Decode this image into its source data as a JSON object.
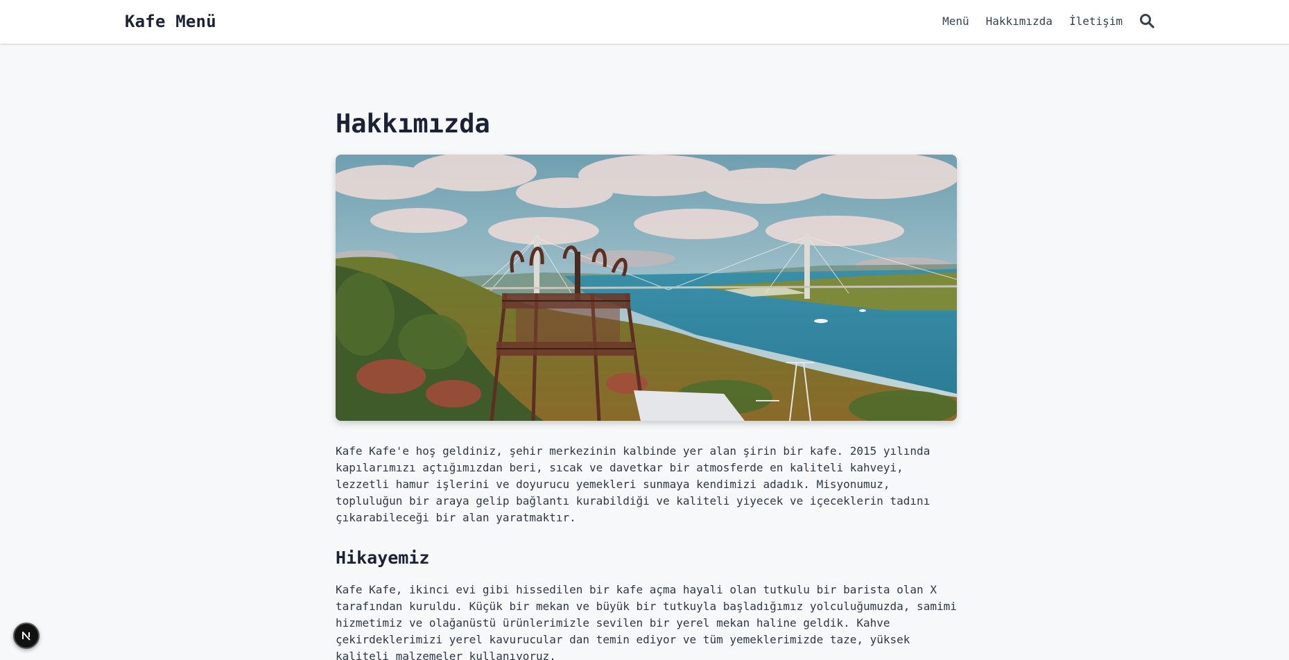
{
  "header": {
    "brand": "Kafe Menü",
    "nav": [
      "Menü",
      "Hakkımızda",
      "İletişim"
    ],
    "search_icon": "search-icon"
  },
  "page": {
    "title": "Hakkımızda",
    "hero_image": "istanbul-bosphorus-bridge-observation-tower-photo",
    "intro": "Kafe Kafe'e hoş geldiniz, şehir merkezinin kalbinde yer alan şirin bir kafe. 2015 yılında kapılarımızı açtığımızdan beri, sıcak ve davetkar bir atmosferde en kaliteli kahveyi, lezzetli hamur işlerini ve doyurucu yemekleri sunmaya kendimizi adadık. Misyonumuz, topluluğun bir araya gelip bağlantı kurabildiği ve kaliteli yiyecek ve içeceklerin tadını çıkarabileceği bir alan yaratmaktır.",
    "story_title": "Hikayemiz",
    "story": "Kafe Kafe, ikinci evi gibi hissedilen bir kafe açma hayali olan tutkulu bir barista olan X tarafından kuruldu. Küçük bir mekan ve büyük bir tutkuyla başladığımız yolculuğumuzda, samimi hizmetimiz ve olağanüstü ürünlerimizle sevilen bir yerel mekan haline geldik. Kahve çekirdeklerimizi yerel kavurucular dan temin ediyor ve tüm yemeklerimizde taze, yüksek kaliteli malzemeler kullanıyoruz."
  },
  "overlay": {
    "badge_icon": "nextjs-n-icon"
  },
  "colors": {
    "background": "#f7f8fa",
    "header_bg": "#ffffff",
    "heading": "#1a2233",
    "text": "#2d3748"
  }
}
